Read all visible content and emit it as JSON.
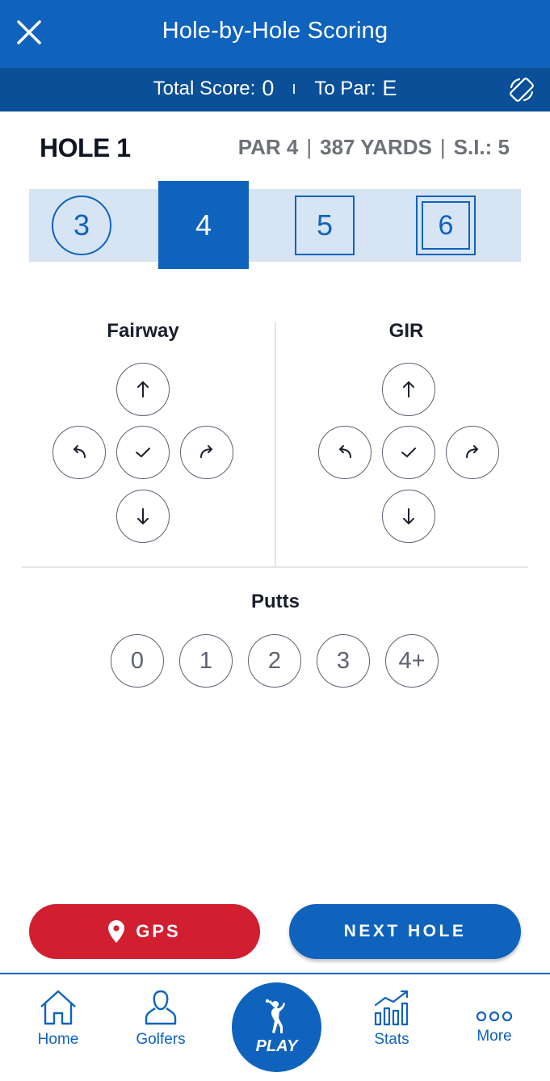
{
  "header": {
    "title": "Hole-by-Hole Scoring",
    "close_icon": "close-icon",
    "rotate_icon": "rotate-screen-icon"
  },
  "score_summary": {
    "total_label": "Total Score:",
    "total_value": "0",
    "to_par_label": "To Par:",
    "to_par_value": "E"
  },
  "hole": {
    "title": "HOLE 1",
    "par": "PAR 4",
    "yards": "387 YARDS",
    "stroke_index": "S.I.: 5"
  },
  "score_options": [
    {
      "value": "3",
      "marker": "circle"
    },
    {
      "value": "4",
      "marker": "selected"
    },
    {
      "value": "5",
      "marker": "square"
    },
    {
      "value": "6",
      "marker": "double-square"
    }
  ],
  "fairway": {
    "title": "Fairway",
    "buttons": [
      "arrow-up-icon",
      "arrow-left-curve-icon",
      "check-icon",
      "arrow-right-curve-icon",
      "arrow-down-icon"
    ]
  },
  "gir": {
    "title": "GIR",
    "buttons": [
      "arrow-up-icon",
      "arrow-left-curve-icon",
      "check-icon",
      "arrow-right-curve-icon",
      "arrow-down-icon"
    ]
  },
  "putts": {
    "title": "Putts",
    "options": [
      "0",
      "1",
      "2",
      "3",
      "4+"
    ]
  },
  "actions": {
    "gps_label": "GPS",
    "next_label": "NEXT HOLE"
  },
  "nav": {
    "home": "Home",
    "golfers": "Golfers",
    "play": "PLAY",
    "stats": "Stats",
    "more": "More"
  },
  "colors": {
    "primary": "#0f63bd",
    "primary_dark": "#0a4f97",
    "strip": "#d6e4f3",
    "gps_red": "#d11f31",
    "outline_gray": "#5d6272"
  }
}
